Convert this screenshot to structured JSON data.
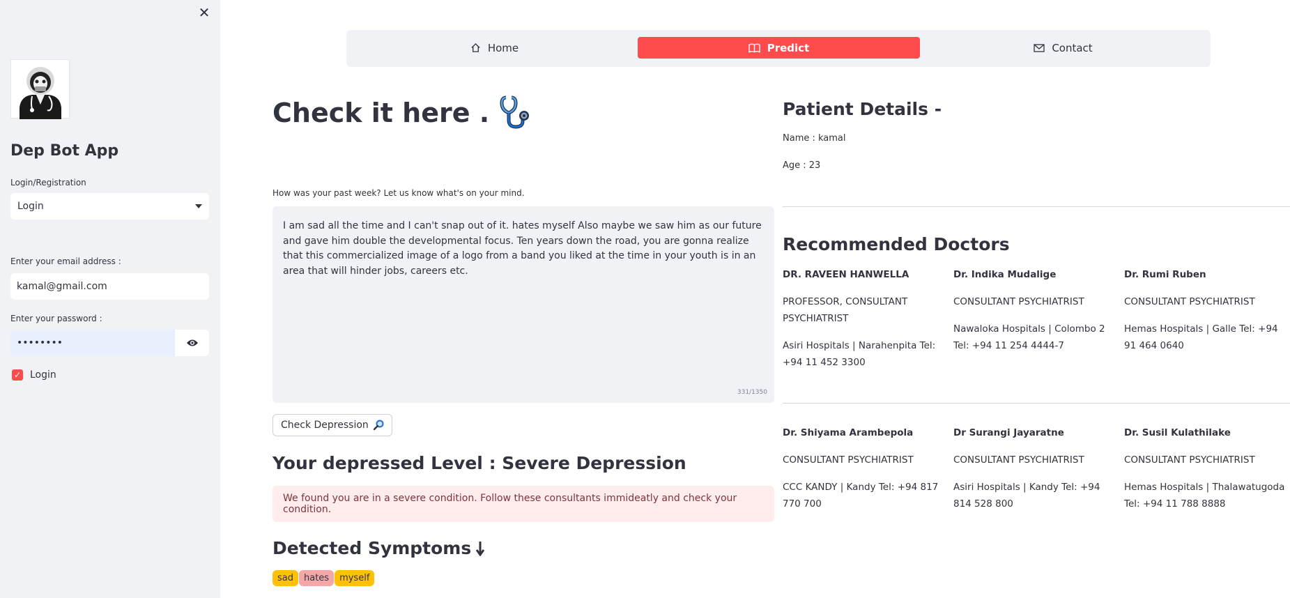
{
  "sidebar": {
    "close_icon": "close-icon",
    "app_title": "Dep Bot App",
    "mode_label": "Login/Registration",
    "mode_value": "Login",
    "email_label": "Enter your email address :",
    "email_value": "kamal@gmail.com",
    "password_label": "Enter your password :",
    "password_value": "••••••••",
    "login_checkbox_label": "Login",
    "login_checked": true
  },
  "nav": {
    "items": [
      {
        "label": "Home",
        "icon": "home-icon",
        "active": false
      },
      {
        "label": "Predict",
        "icon": "book-open-icon",
        "active": true
      },
      {
        "label": "Contact",
        "icon": "envelope-icon",
        "active": false
      }
    ]
  },
  "main": {
    "title": "Check it here .",
    "title_icon": "stethoscope-icon",
    "prompt_label": "How was your past week? Let us know what's on your mind.",
    "text_value": "I am sad all the time and I can't snap out of it.  hates myself Also maybe we saw him as our future and gave him double the developmental focus. Ten years down the road,  you are gonna realize that this commercialized image of a logo from a band you liked at the time in your youth is in an area that will hinder jobs, careers etc.",
    "char_counter": "331/1350",
    "check_button_label": "Check Depression",
    "level_text": "Your depressed Level : Severe Depression",
    "alert_text": "We found you are in a severe condition. Follow these consultants immideatly and check your condition.",
    "symptoms_heading": "Detected Symptoms",
    "symptoms": [
      {
        "word": "sad",
        "color": "#ffc107"
      },
      {
        "word": "hates",
        "color": "#f4a7a7"
      },
      {
        "word": "myself",
        "color": "#ffc107"
      }
    ]
  },
  "patient": {
    "heading": "Patient Details -",
    "name_line": "Name : kamal",
    "age_line": "Age : 23"
  },
  "doctors": {
    "heading": "Recommended Doctors",
    "list": [
      {
        "name": "DR. RAVEEN HANWELLA",
        "title": "PROFESSOR, CONSULTANT PSYCHIATRIST",
        "contact": "Asiri Hospitals | Narahenpita Tel: +94 11 452 3300"
      },
      {
        "name": "Dr. Indika Mudalige",
        "title": "CONSULTANT PSYCHIATRIST",
        "contact": "Nawaloka Hospitals | Colombo 2 Tel: +94 11 254 4444-7"
      },
      {
        "name": "Dr. Rumi Ruben",
        "title": "CONSULTANT PSYCHIATRIST",
        "contact": "Hemas Hospitals | Galle Tel: +94 91 464 0640"
      },
      {
        "name": "Dr. Shiyama Arambepola",
        "title": "CONSULTANT PSYCHIATRIST",
        "contact": "CCC KANDY | Kandy Tel: +94 817 770 700"
      },
      {
        "name": "Dr Surangi Jayaratne",
        "title": "CONSULTANT PSYCHIATRIST",
        "contact": "Asiri Hospitals | Kandy Tel: +94 814 528 800"
      },
      {
        "name": "Dr. Susil Kulathilake",
        "title": "CONSULTANT PSYCHIATRIST",
        "contact": "Hemas Hospitals | Thalawatugoda Tel: +94 11 788 8888"
      }
    ]
  },
  "colors": {
    "accent": "#ff4b4b",
    "sidebar_bg": "#f0f2f6",
    "alert_bg": "#ffecec",
    "alert_text": "#7d353b"
  }
}
